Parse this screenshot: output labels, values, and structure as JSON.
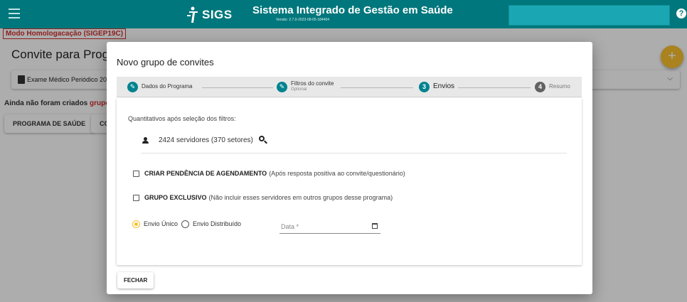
{
  "header": {
    "logo_text": "SIGS",
    "title": "Sistema Integrado de Gestão em Saúde",
    "version": "Versão: 2.7.0-2023-08-05-184404",
    "help_label": "?"
  },
  "environment_badge": "Modo Homologacação (SIGEP19C)",
  "page": {
    "title": "Convite para Progran",
    "program_label": "Exame Médico Periódico 2023",
    "info_text": "Ainda não foram criados ",
    "info_highlight": "grupo",
    "buttons": [
      "PROGRAMA DE SAÚDE",
      "CO"
    ],
    "fab_label": "+",
    "expand_icon": "chevron-down"
  },
  "dialog": {
    "title": "Novo grupo de convites",
    "steps": [
      {
        "number": "",
        "label": "Dados do Programa",
        "sublabel": "",
        "state": "done"
      },
      {
        "number": "",
        "label": "Filtros do convite",
        "sublabel": "Optional",
        "state": "done"
      },
      {
        "number": "3",
        "label": "Envios",
        "sublabel": "",
        "state": "active"
      },
      {
        "number": "4",
        "label": "Resumo",
        "sublabel": "",
        "state": "pending"
      }
    ],
    "quantitativos_title": "Quantitativos após seleção dos filtros:",
    "servers_summary": "2424 servidores (370 setores)",
    "checkbox_pendencia": {
      "label": "CRIAR PENDÊNCIA DE AGENDAMENTO",
      "note": "(Após resposta positiva ao convite/questionário)",
      "checked": false
    },
    "checkbox_exclusivo": {
      "label": "GRUPO EXCLUSIVO",
      "note": "(Não incluir esses servidores em outros grupos desse programa)",
      "checked": false
    },
    "radio_unico": "Envio Único",
    "radio_distribuido": "Envio Distribuído",
    "selected_envio": "Envio Único",
    "date_placeholder": "Data *",
    "close_button": "FECHAR"
  },
  "colors": {
    "header_bg": "#00777c",
    "accent_teal": "#00838f",
    "accent_yellow": "#fbc02d",
    "badge_red": "#d32f2f"
  }
}
